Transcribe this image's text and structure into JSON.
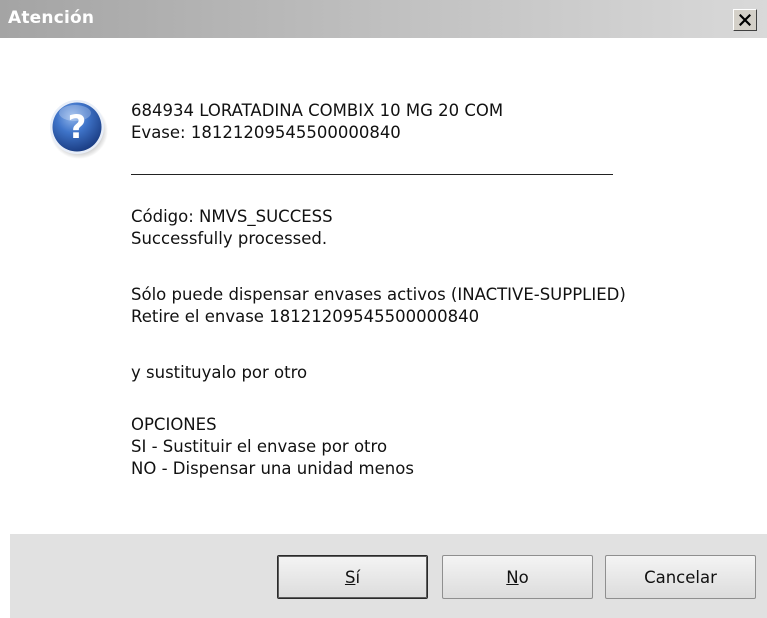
{
  "window": {
    "title": "Atención",
    "close_symbol": "X"
  },
  "icon": {
    "name": "question-icon",
    "glyph": "?",
    "color": "#2a5fb0"
  },
  "product": {
    "line1": "684934 LORATADINA COMBIX 10 MG 20 COM",
    "line2": "Evase: 18121209545500000840"
  },
  "status": {
    "code_line": "Código: NMVS_SUCCESS",
    "message_line": "Successfully processed."
  },
  "warning": {
    "line1": "Sólo puede dispensar envases activos (INACTIVE-SUPPLIED)",
    "line2": "Retire el envase 18121209545500000840"
  },
  "instruction": "y sustituyalo por otro",
  "options": {
    "header": "OPCIONES",
    "option_si": "SI - Sustituir el envase por otro",
    "option_no": "NO - Dispensar una unidad menos"
  },
  "buttons": {
    "si_accel": "S",
    "si_rest": "í",
    "no_accel": "N",
    "no_rest": "o",
    "cancel": "Cancelar"
  }
}
